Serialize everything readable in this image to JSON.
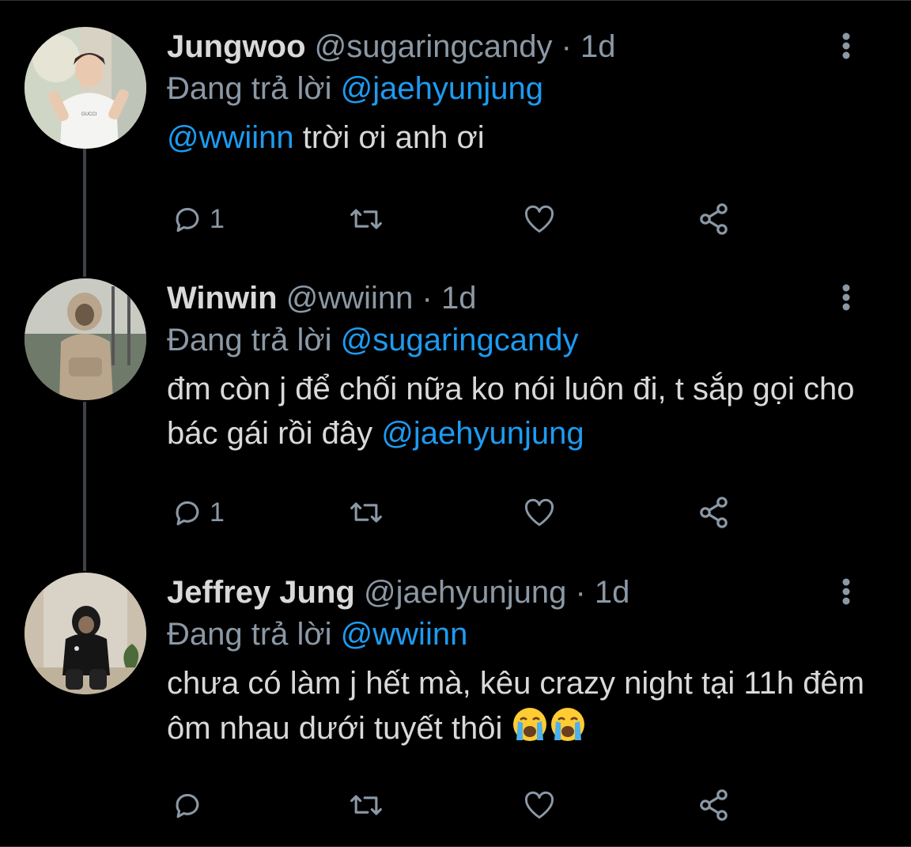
{
  "colors": {
    "background": "#000000",
    "text": "#d9d9d9",
    "secondary": "#8b98a5",
    "accent": "#1d9bf0",
    "thread_line": "#3d4248"
  },
  "tweets": [
    {
      "display_name": "Jungwoo",
      "handle": "@sugaringcandy",
      "separator": "·",
      "time": "1d",
      "replying_prefix": "Đang trả lời",
      "replying_to": "@jaehyunjung",
      "body_mention": "@wwiinn",
      "body_text": " trời ơi anh ơi",
      "reply_count": "1",
      "avatar": "person-avatar-white-tshirt"
    },
    {
      "display_name": "Winwin",
      "handle": "@wwiinn",
      "separator": "·",
      "time": "1d",
      "replying_prefix": "Đang trả lời",
      "replying_to": "@sugaringcandy",
      "body_text": "đm còn j để chối nữa ko nói luôn đi, t sắp gọi cho bác gái rồi đây ",
      "body_mention": "@jaehyunjung",
      "reply_count": "1",
      "avatar": "person-avatar-hoodie"
    },
    {
      "display_name": "Jeffrey Jung",
      "handle": "@jaehyunjung",
      "separator": "·",
      "time": "1d",
      "replying_prefix": "Đang trả lời",
      "replying_to": "@wwiinn",
      "body_text": "chưa có làm j hết mà, kêu crazy night tại 11h đêm ôm nhau dưới tuyết thôi",
      "body_emoji": "loudly-crying-face",
      "reply_count": "",
      "avatar": "person-avatar-crouching"
    }
  ],
  "icons": {
    "reply": "reply-icon",
    "retweet": "retweet-icon",
    "like": "heart-icon",
    "share": "share-icon",
    "more": "more-vertical-icon"
  }
}
